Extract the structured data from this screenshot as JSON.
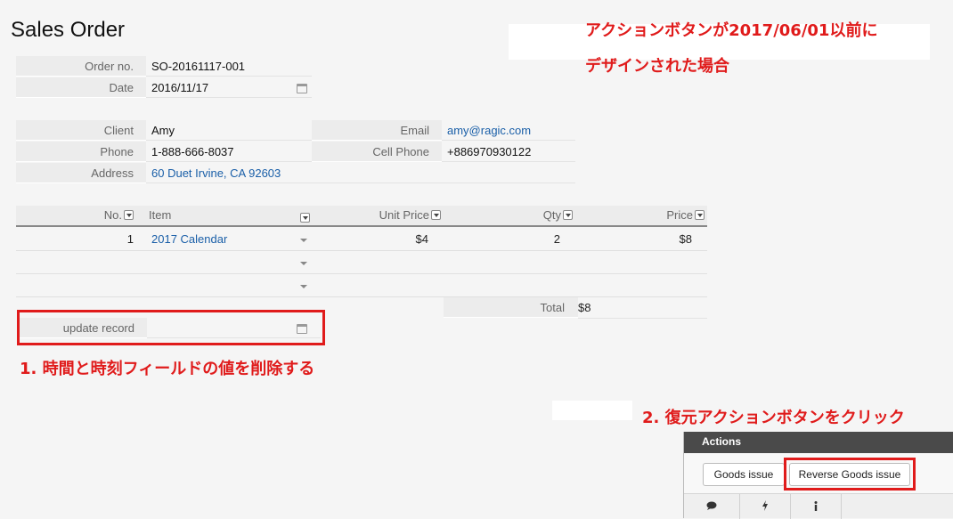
{
  "page": {
    "title": "Sales Order"
  },
  "form": {
    "order_no_label": "Order no.",
    "order_no": "SO-20161117-001",
    "date_label": "Date",
    "date": "2016/11/17",
    "client_label": "Client",
    "client": "Amy",
    "email_label": "Email",
    "email": "amy@ragic.com",
    "phone_label": "Phone",
    "phone": "1-888-666-8037",
    "cell_label": "Cell Phone",
    "cell": "+886970930122",
    "address_label": "Address",
    "address": "60 Duet Irvine, CA 92603",
    "update_record_label": "update record",
    "update_record_value": ""
  },
  "grid": {
    "headers": [
      "No.",
      "Item",
      "Unit Price",
      "Qty",
      "Price"
    ],
    "rows": [
      {
        "no": "1",
        "item": "2017 Calendar",
        "unit_price": "$4",
        "qty": "2",
        "price": "$8"
      },
      {
        "no": "",
        "item": "",
        "unit_price": "",
        "qty": "",
        "price": ""
      },
      {
        "no": "",
        "item": "",
        "unit_price": "",
        "qty": "",
        "price": ""
      }
    ],
    "total_label": "Total",
    "total": "$8"
  },
  "annotations": {
    "top": "アクションボタンが2017/06/01以前に",
    "top2": "デザインされた場合",
    "step1": "1. 時間と時刻フィールドの値を削除する",
    "step2": "2. 復元アクションボタンをクリック"
  },
  "actions": {
    "title": "Actions",
    "buttons": [
      "Goods issue",
      "Reverse Goods issue"
    ],
    "footer_icons": [
      "comment-icon",
      "bolt-icon",
      "info-icon"
    ]
  },
  "colors": {
    "annotation_red": "#e01b1b",
    "link_blue": "#1a5fa8",
    "panel_header": "#4a4a4a"
  }
}
